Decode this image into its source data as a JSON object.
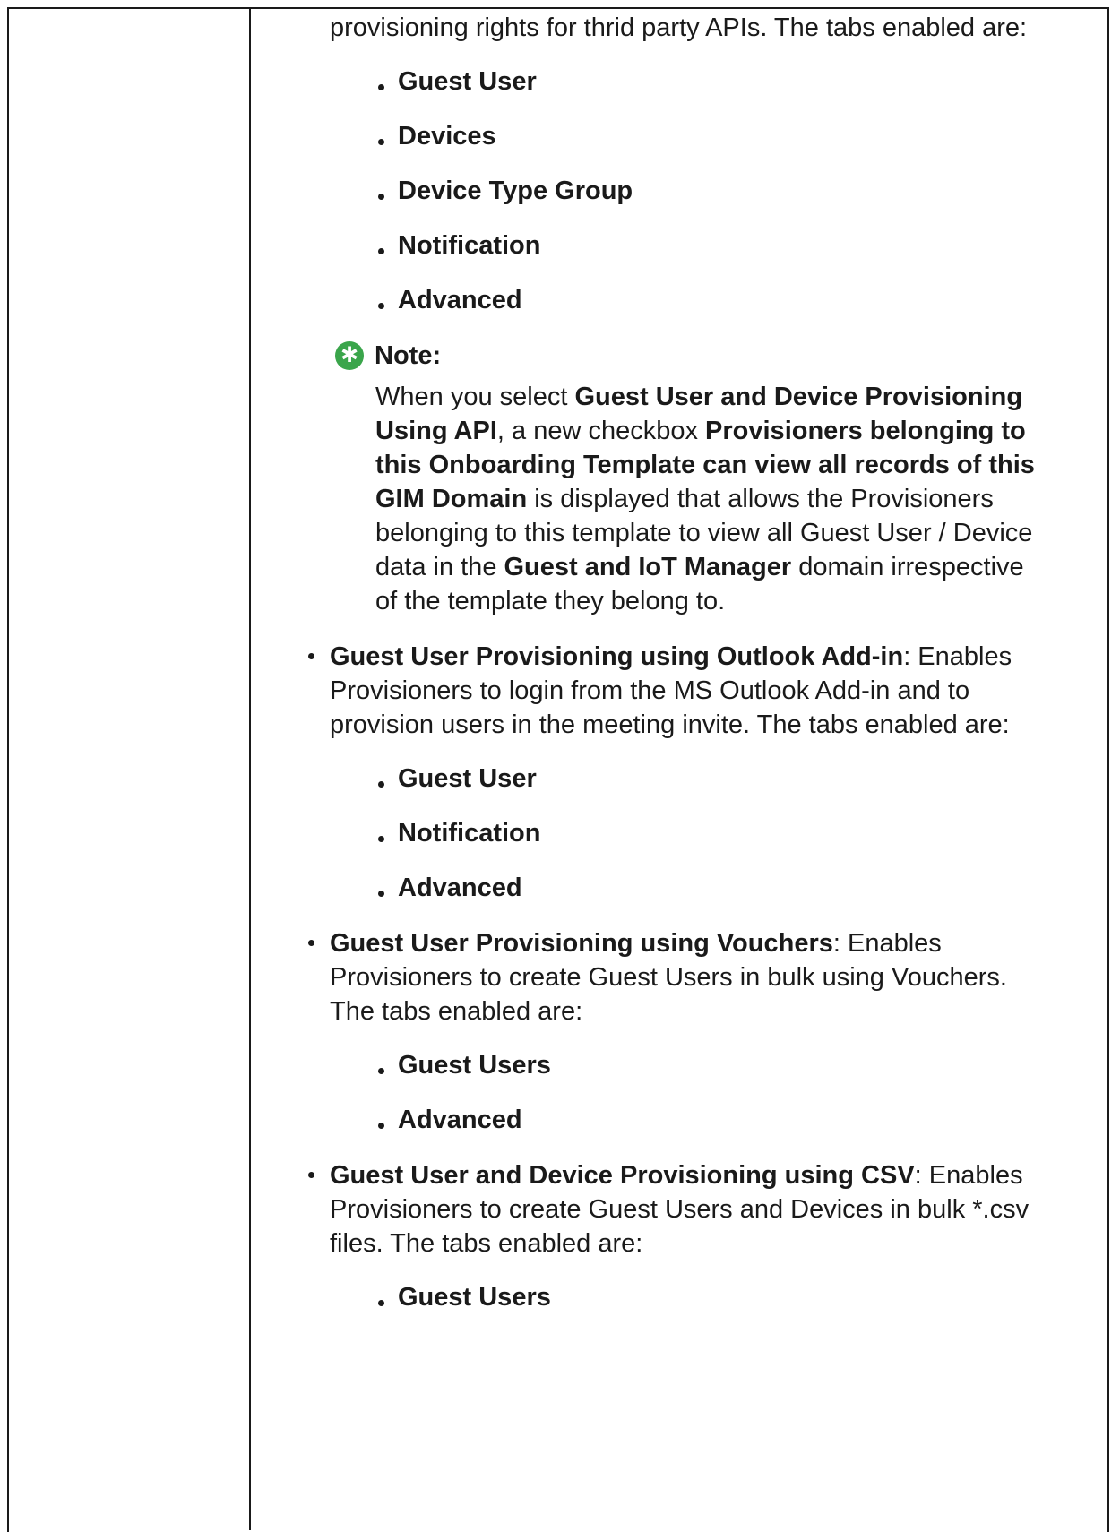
{
  "intro": {
    "text": "provisioning rights for thrid party APIs. The tabs enabled are:"
  },
  "api_tabs": [
    "Guest User",
    "Devices",
    "Device Type Group",
    "Notification",
    "Advanced"
  ],
  "note": {
    "icon": "green-star-note-icon",
    "title": "Note:",
    "t1": "When you select ",
    "b1": "Guest User and Device Provisioning Using API",
    "t2": ", a new checkbox ",
    "b2": "Provisioners belonging to this Onboarding Template can view all records of this GIM Domain",
    "t3": " is displayed that allows the Provisioners belonging to this template to view all Guest User / Device data in the ",
    "b3": "Guest and IoT Manager",
    "t4": " domain irrespective of the template they belong to."
  },
  "items": [
    {
      "title": "Guest User Provisioning using Outlook Add-in",
      "desc": ": Enables Provisioners to login from the MS Outlook Add-in and to provision users in the meeting invite. The tabs enabled are:",
      "tabs": [
        "Guest User",
        "Notification",
        "Advanced"
      ]
    },
    {
      "title": "Guest User Provisioning using Vouchers",
      "desc": ": Enables Provisioners to create Guest Users in bulk using Vouchers. The tabs enabled are:",
      "tabs": [
        "Guest Users",
        "Advanced"
      ]
    },
    {
      "title": "Guest User and Device Provisioning using CSV",
      "desc": ": Enables Provisioners to create Guest Users and Devices in bulk *.csv files. The tabs enabled are:",
      "tabs": [
        "Guest Users"
      ]
    }
  ]
}
